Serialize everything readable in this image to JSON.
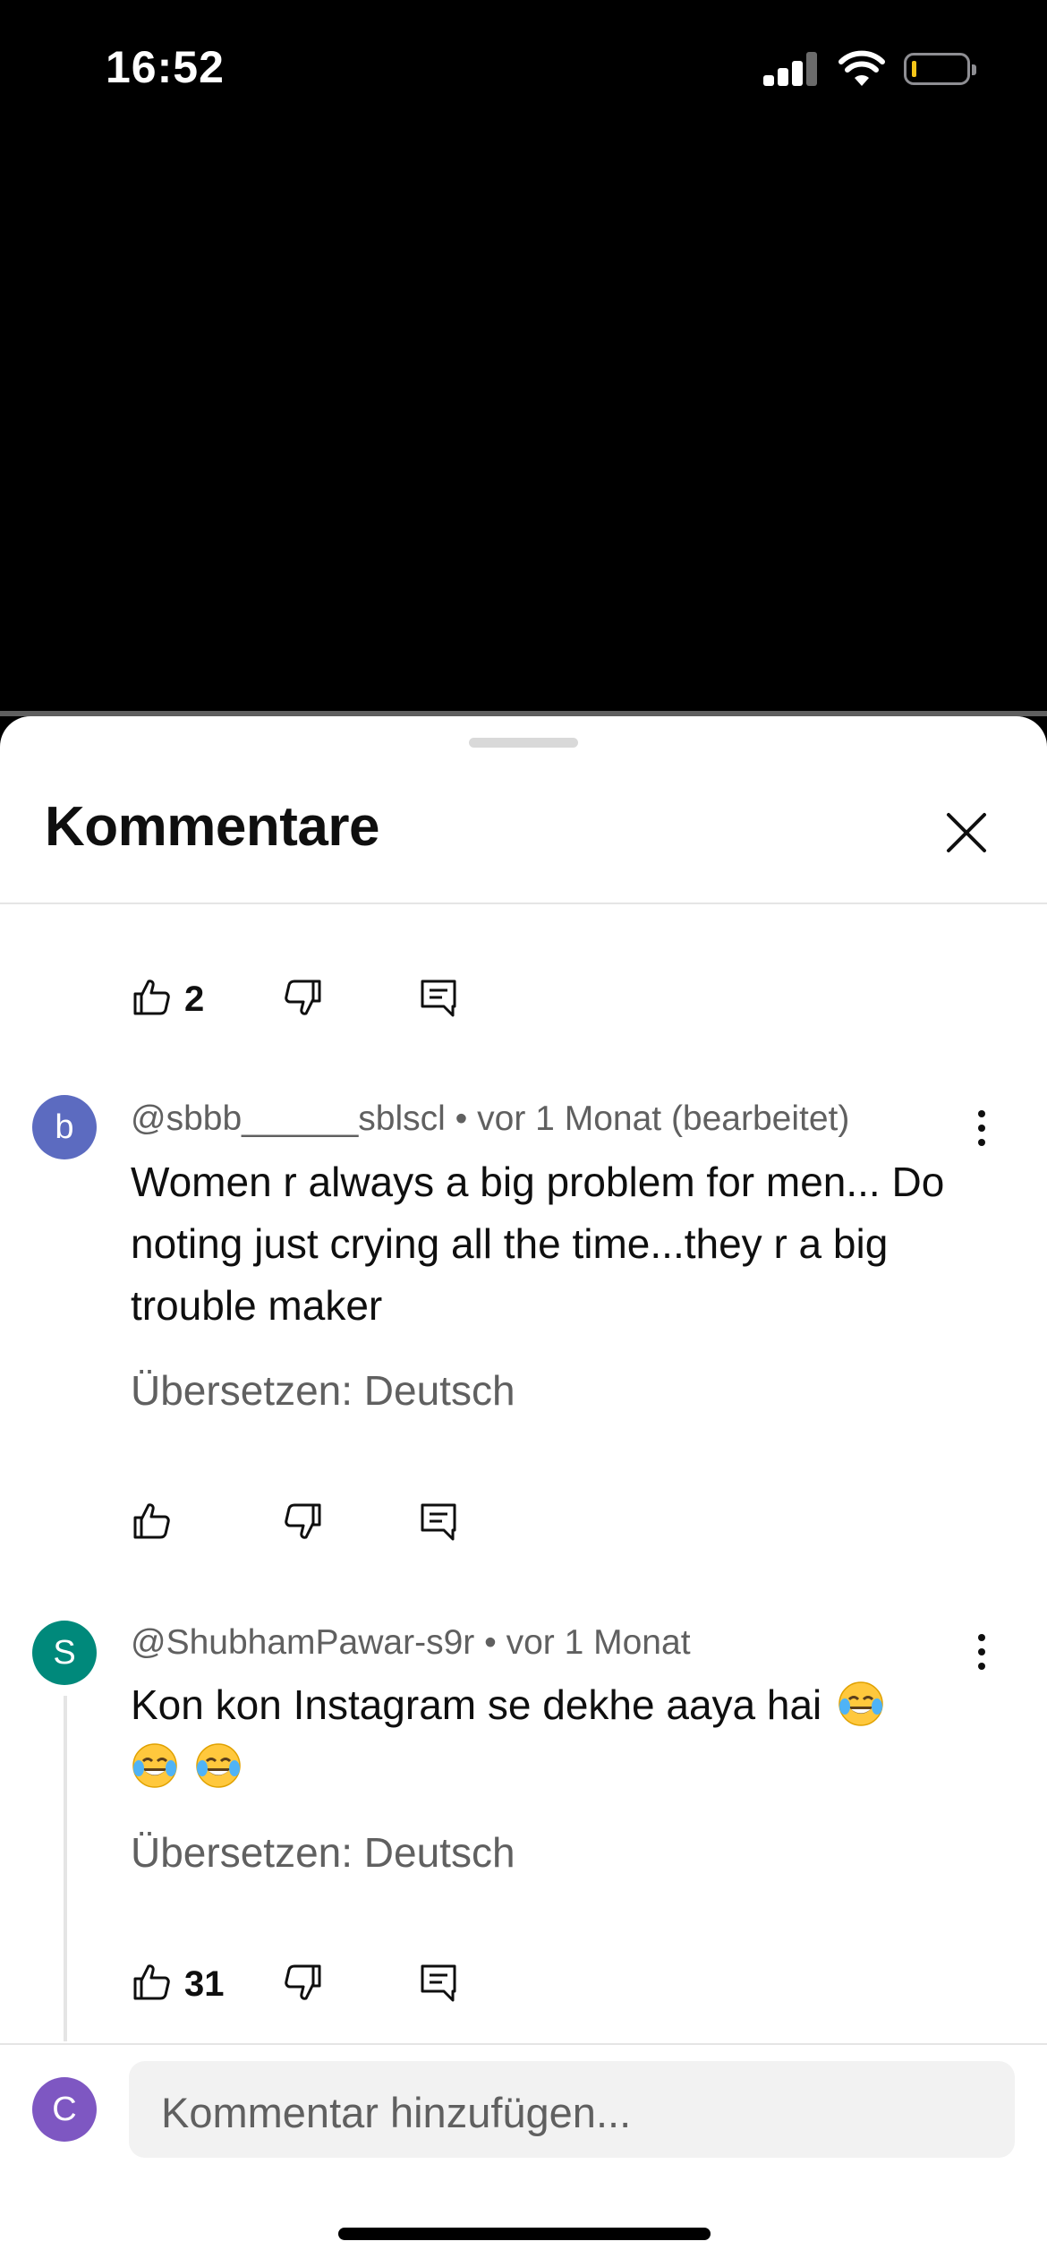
{
  "status_bar": {
    "time": "16:52"
  },
  "sheet": {
    "title": "Kommentare"
  },
  "comments": [
    {
      "like_count": "2"
    },
    {
      "avatar_letter": "b",
      "avatar_color": "#5c6bc0",
      "author": "@sbbb______sblscl",
      "time": "vor 1 Monat (bearbeitet)",
      "text": "Women r always a big problem for men... Do noting just crying all the time...they r a big trouble maker",
      "translate": "Übersetzen: Deutsch",
      "like_count": ""
    },
    {
      "avatar_letter": "S",
      "avatar_color": "#00897b",
      "author": "@ShubhamPawar-s9r",
      "time": "vor 1 Monat",
      "text": "Kon kon Instagram se dekhe aaya hai",
      "emojis": [
        "face-with-tears-of-joy",
        "face-with-tears-of-joy",
        "face-with-tears-of-joy"
      ],
      "translate": "Übersetzen: Deutsch",
      "like_count": "31"
    }
  ],
  "composer": {
    "avatar_letter": "C",
    "avatar_color": "#7e57c2",
    "placeholder": "Kommentar hinzufügen..."
  },
  "separator": "•"
}
